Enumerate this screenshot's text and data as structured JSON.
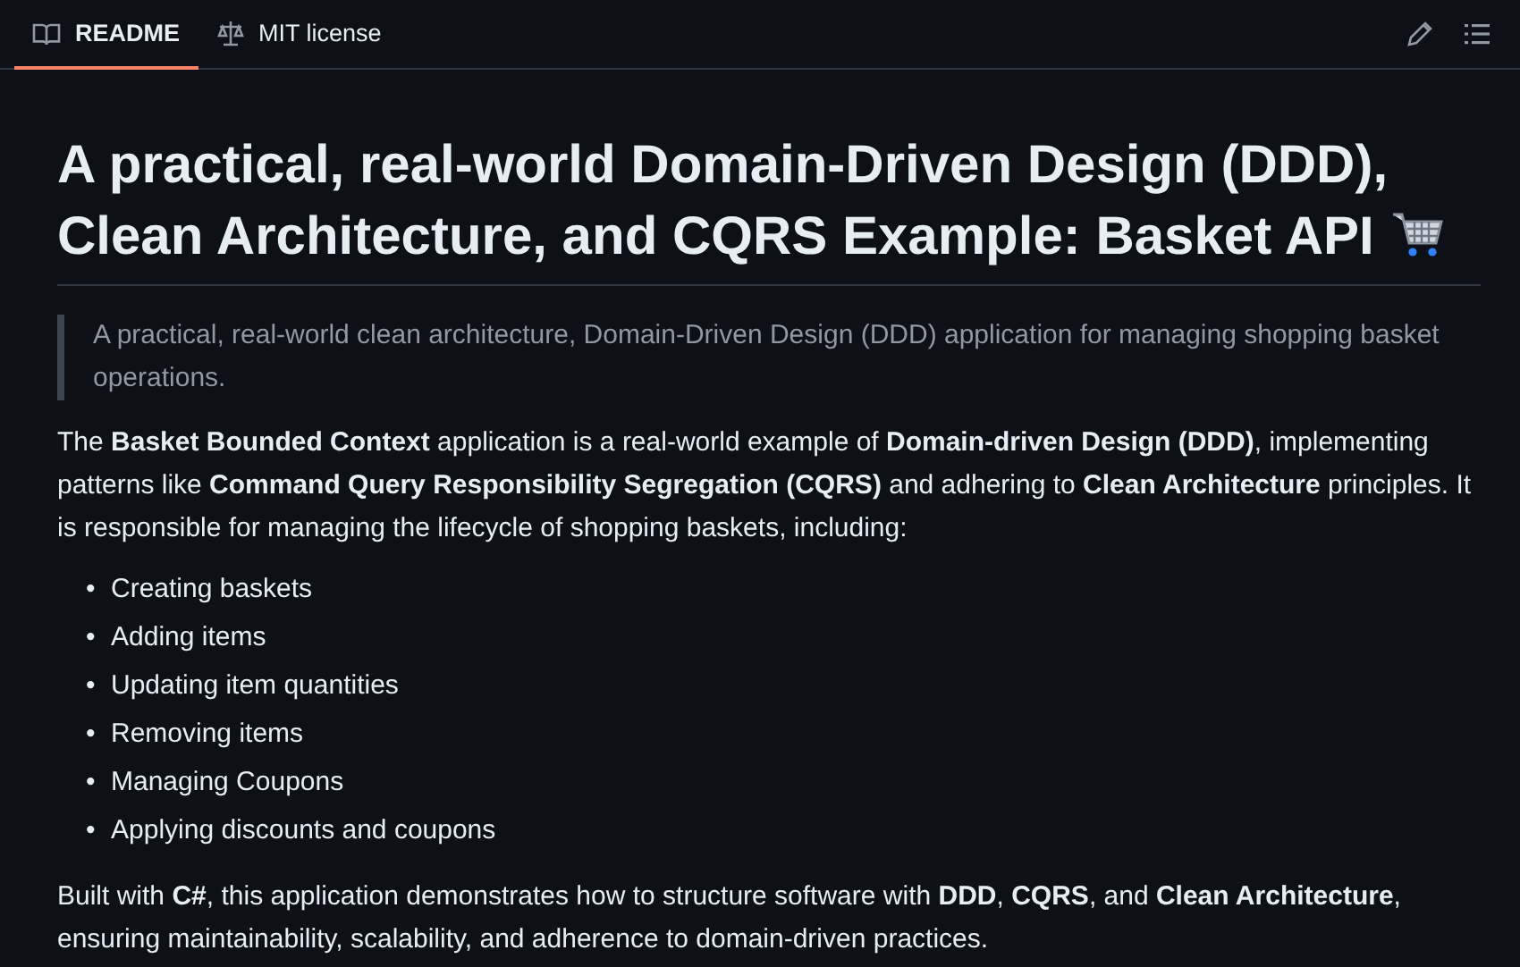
{
  "tabs": [
    {
      "label": "README",
      "selected": true
    },
    {
      "label": "MIT license",
      "selected": false
    }
  ],
  "bullet": "•",
  "title": "A practical, real-world Domain-Driven Design (DDD), Clean Architecture, and CQRS Example: Basket API",
  "quote": "A practical, real-world clean architecture, Domain-Driven Design (DDD) application for managing shopping basket operations.",
  "intro": "The **Basket Bounded Context** application is a real-world example of **Domain-driven Design (DDD)**, implementing patterns like **Command Query Responsibility Segregation (CQRS)** and adhering to **Clean Architecture** principles. It is responsible for managing the lifecycle of shopping baskets, including:",
  "features": [
    "Creating baskets",
    "Adding items",
    "Updating item quantities",
    "Removing items",
    "Managing Coupons",
    "Applying discounts and coupons"
  ],
  "closing": "Built with **C#**, this application demonstrates how to structure software with **DDD**, **CQRS**, and **Clean Architecture**, ensuring maintainability, scalability, and adherence to domain-driven practices."
}
